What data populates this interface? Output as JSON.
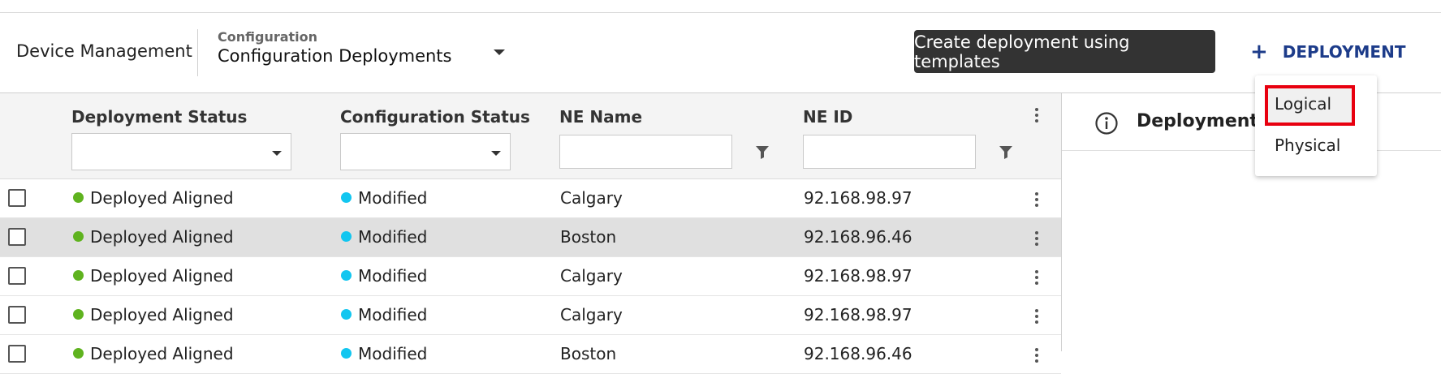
{
  "header": {
    "app_title": "Device Management",
    "breadcrumb_sup": "Configuration",
    "breadcrumb_main": "Configuration Deployments",
    "templates_button": "Create deployment using templates",
    "deployment_button": "DEPLOYMENT",
    "deployment_plus": "+"
  },
  "table": {
    "columns": [
      "Deployment Status",
      "Configuration Status",
      "NE Name",
      "NE ID"
    ],
    "rows": [
      {
        "deployment_status": "Deployed Aligned",
        "config_status": "Modified",
        "ne_name": "Calgary",
        "ne_id": "92.168.98.97"
      },
      {
        "deployment_status": "Deployed Aligned",
        "config_status": "Modified",
        "ne_name": "Boston",
        "ne_id": "92.168.96.46"
      },
      {
        "deployment_status": "Deployed Aligned",
        "config_status": "Modified",
        "ne_name": "Calgary",
        "ne_id": "92.168.98.97"
      },
      {
        "deployment_status": "Deployed Aligned",
        "config_status": "Modified",
        "ne_name": "Calgary",
        "ne_id": "92.168.98.97"
      },
      {
        "deployment_status": "Deployed Aligned",
        "config_status": "Modified",
        "ne_name": "Boston",
        "ne_id": "92.168.96.46"
      }
    ],
    "status_colors": {
      "deployed_aligned": "#5fb31f",
      "modified": "#12c6f0"
    }
  },
  "panel": {
    "title": "Deployment D"
  },
  "menu": {
    "items": [
      "Logical",
      "Physical"
    ]
  },
  "colors": {
    "accent": "#1d3c8a",
    "dark_button": "#333333",
    "highlight_box": "#e8000f"
  }
}
